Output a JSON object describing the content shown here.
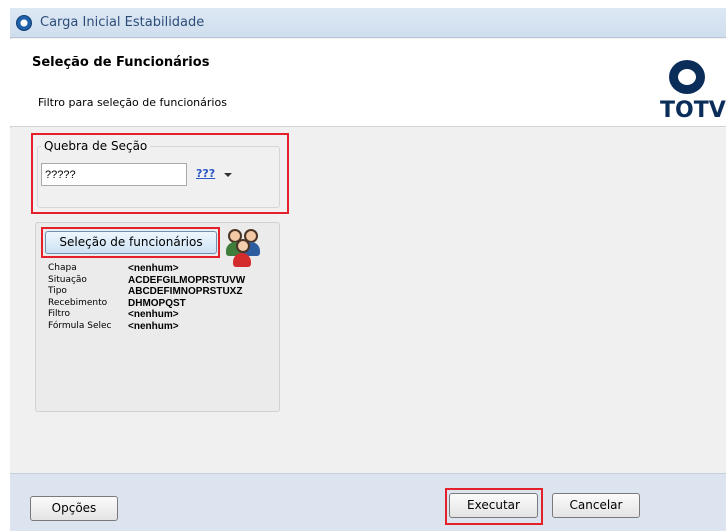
{
  "window": {
    "title": "Carga Inicial Estabilidade"
  },
  "header": {
    "title": "Seleção de Funcionários",
    "subtitle": "Filtro para seleção de funcionários",
    "logo": "TOTVS"
  },
  "section_break": {
    "label": "Quebra de Seção",
    "value": "?????",
    "lookup_label": "???"
  },
  "employee_selection": {
    "button_label": "Seleção de funcionários",
    "fields": [
      {
        "label": "Chapa",
        "value": "<nenhum>"
      },
      {
        "label": "Situação",
        "value": "ACDEFGILMOPRSTUVW"
      },
      {
        "label": "Tipo",
        "value": "ABCDEFIMNOPRSTUXZ"
      },
      {
        "label": "Recebimento",
        "value": "DHMOPQST"
      },
      {
        "label": "Filtro",
        "value": "<nenhum>"
      },
      {
        "label": "Fórmula Selec",
        "value": "<nenhum>"
      }
    ]
  },
  "footer": {
    "options_label": "Opções",
    "execute_label": "Executar",
    "cancel_label": "Cancelar"
  },
  "colors": {
    "highlight": "#e4202a",
    "brand": "#0a2d5a"
  }
}
